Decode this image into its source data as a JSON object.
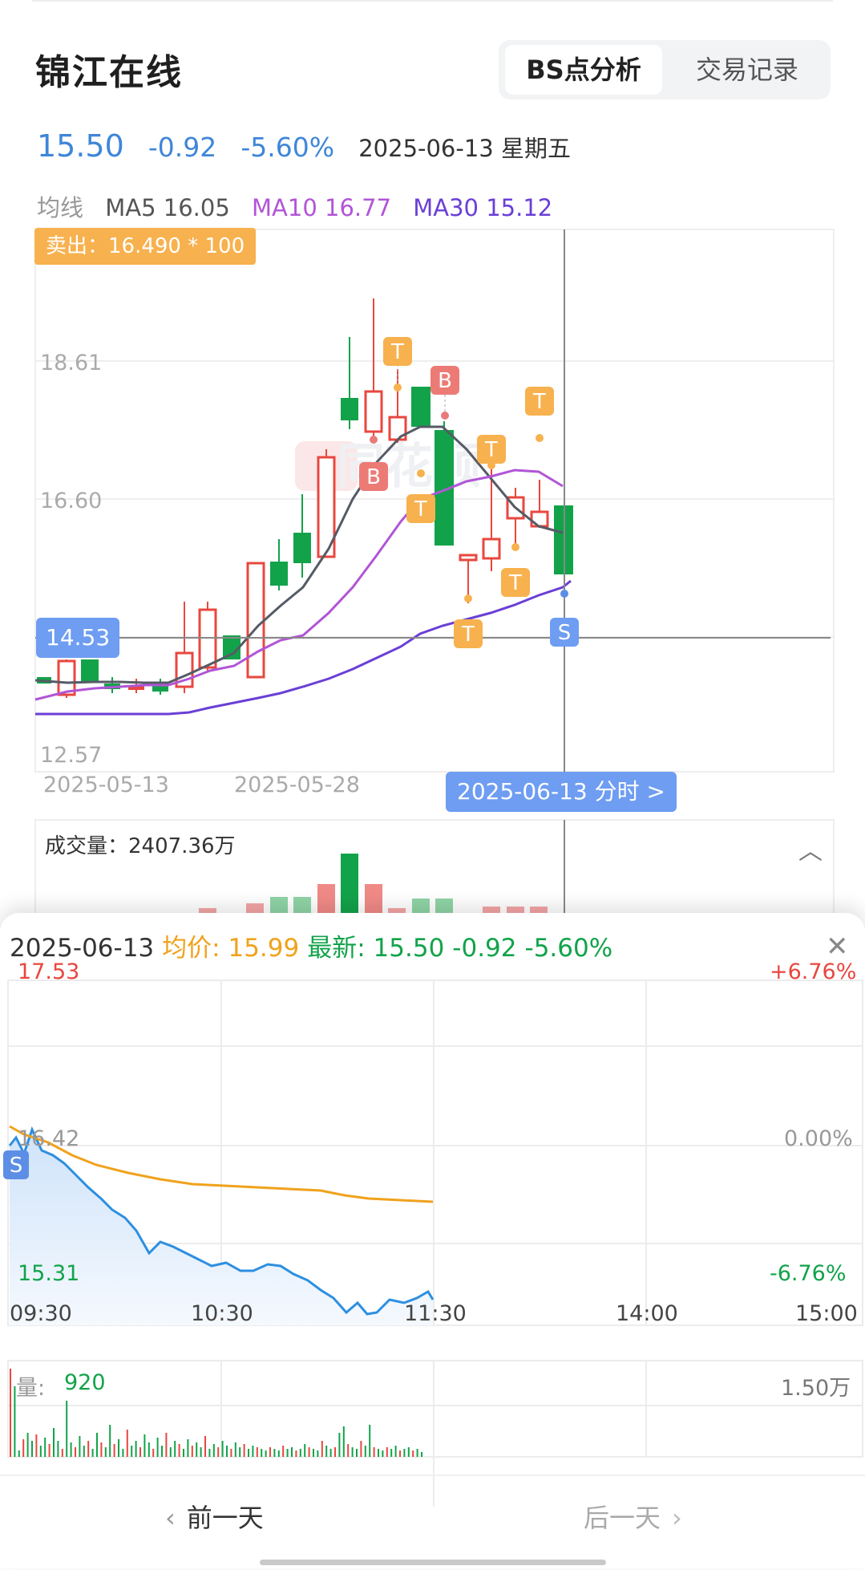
{
  "header": {
    "title": "锦江在线",
    "tabs": [
      "BS点分析",
      "交易记录"
    ]
  },
  "quote": {
    "price": "15.50",
    "change": "-0.92",
    "pct": "-5.60%",
    "date": "2025-06-13 星期五"
  },
  "ma": {
    "label": "均线",
    "ma5": "MA5 16.05",
    "ma10": "MA10 16.77",
    "ma30": "MA30 15.12"
  },
  "kline": {
    "sell_tip": "卖出：16.490 * 100",
    "y_ticks": [
      "18.61",
      "16.60",
      "12.57"
    ],
    "x_ticks": [
      "2025-05-13",
      "2025-05-28"
    ],
    "cursor_price": "14.53",
    "cursor_date": "2025-06-13 分时 >",
    "markers": [
      "T",
      "B",
      "B",
      "T",
      "T",
      "T",
      "T",
      "T",
      "S"
    ]
  },
  "volume": {
    "label": "成交量：",
    "value": "2407.36万"
  },
  "intraday": {
    "date": "2025-06-13",
    "avg_label": "均价: ",
    "avg": "15.99",
    "last_label": "最新: ",
    "last": "15.50",
    "change": "-0.92",
    "pct": "-5.60%",
    "high": "17.53",
    "high_pct": "+6.76%",
    "base": "16.42",
    "base_pct": "0.00%",
    "low": "15.31",
    "low_pct": "-6.76%",
    "times": [
      "09:30",
      "10:30",
      "11:30",
      "14:00",
      "15:00"
    ],
    "vol_label": "量: ",
    "vol": "920",
    "vol_max": "1.50万",
    "marker": "S"
  },
  "footer": {
    "prev": "前一天",
    "next": "后一天"
  },
  "colors": {
    "up": "#e8473f",
    "down": "#12a34a",
    "blue": "#3f86d9",
    "orange": "#f7a21b",
    "purple": "#9b4fd8",
    "violet": "#6e3fd9"
  }
}
